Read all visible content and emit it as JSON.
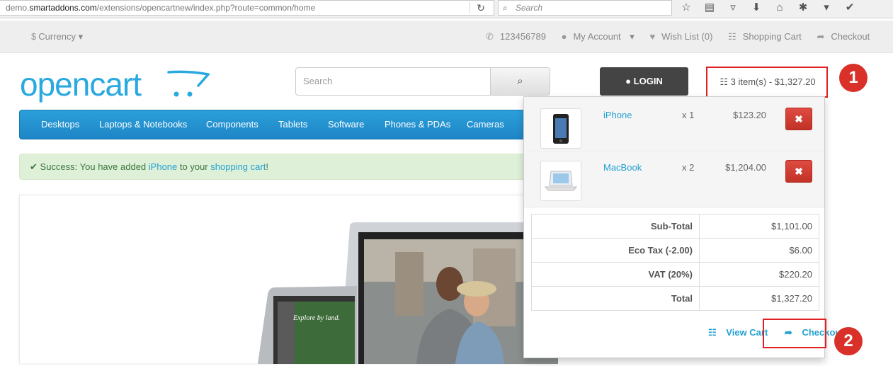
{
  "browser": {
    "url_prefix": "demo.",
    "url_domain": "smartaddons.com",
    "url_path": "/extensions/opencartnew/index.php?route=common/home",
    "search_placeholder": "Search"
  },
  "top_bar": {
    "currency": "Currency",
    "phone": "123456789",
    "my_account": "My Account",
    "wish_list": "Wish List (0)",
    "shopping_cart": "Shopping Cart",
    "checkout": "Checkout"
  },
  "header": {
    "logo": "opencart",
    "search_placeholder": "Search",
    "login_label": "LOGIN",
    "cart_label": "3 item(s) - $1,327.20"
  },
  "menu": [
    "Desktops",
    "Laptops & Notebooks",
    "Components",
    "Tablets",
    "Software",
    "Phones & PDAs",
    "Cameras"
  ],
  "alert": {
    "prefix": "Success: You have added",
    "product": "iPhone",
    "middle": "to your",
    "link": "shopping cart",
    "suffix": "!"
  },
  "cart_dropdown": {
    "items": [
      {
        "name": "iPhone",
        "qty": "x 1",
        "price": "$123.20"
      },
      {
        "name": "MacBook",
        "qty": "x 2",
        "price": "$1,204.00"
      }
    ],
    "totals": [
      {
        "label": "Sub-Total",
        "value": "$1,101.00"
      },
      {
        "label": "Eco Tax (-2.00)",
        "value": "$6.00"
      },
      {
        "label": "VAT (20%)",
        "value": "$220.20"
      },
      {
        "label": "Total",
        "value": "$1,327.20"
      }
    ],
    "view_cart": "View Cart",
    "checkout": "Checkout"
  },
  "annotations": [
    "1",
    "2"
  ],
  "colors": {
    "accent": "#23a1d1",
    "menu": "#2ba0da",
    "marker": "#d9302a"
  }
}
